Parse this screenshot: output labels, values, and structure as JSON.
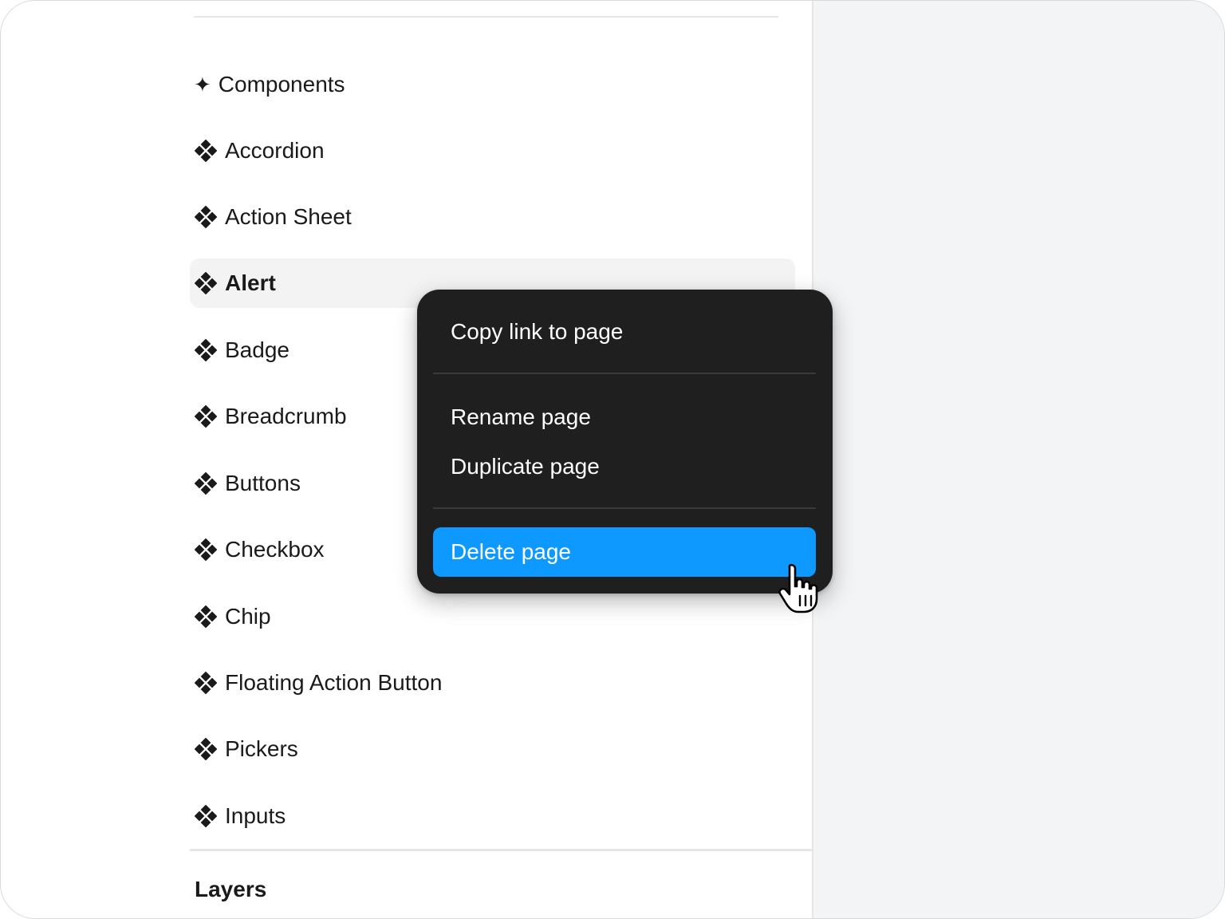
{
  "pages_panel": {
    "section_title": "Components",
    "section_icon": "sparkle-icon",
    "items": [
      {
        "label": "Accordion"
      },
      {
        "label": "Action Sheet"
      },
      {
        "label": "Alert",
        "selected": true
      },
      {
        "label": "Badge"
      },
      {
        "label": "Breadcrumb"
      },
      {
        "label": "Buttons"
      },
      {
        "label": "Checkbox"
      },
      {
        "label": "Chip"
      },
      {
        "label": "Floating Action Button"
      },
      {
        "label": "Pickers"
      },
      {
        "label": "Inputs"
      }
    ],
    "item_icon": "component-icon"
  },
  "layers_panel": {
    "title": "Layers"
  },
  "context_menu": {
    "items": [
      {
        "label": "Copy link to page"
      },
      {
        "label": "Rename page"
      },
      {
        "label": "Duplicate page"
      },
      {
        "label": "Delete page",
        "highlighted": true
      }
    ]
  },
  "colors": {
    "menu_background": "#1f1f1f",
    "highlight": "#0d99ff",
    "selected_row": "#f3f3f3",
    "canvas_background": "#f3f4f6"
  },
  "cursor": "hand-pointer-icon"
}
